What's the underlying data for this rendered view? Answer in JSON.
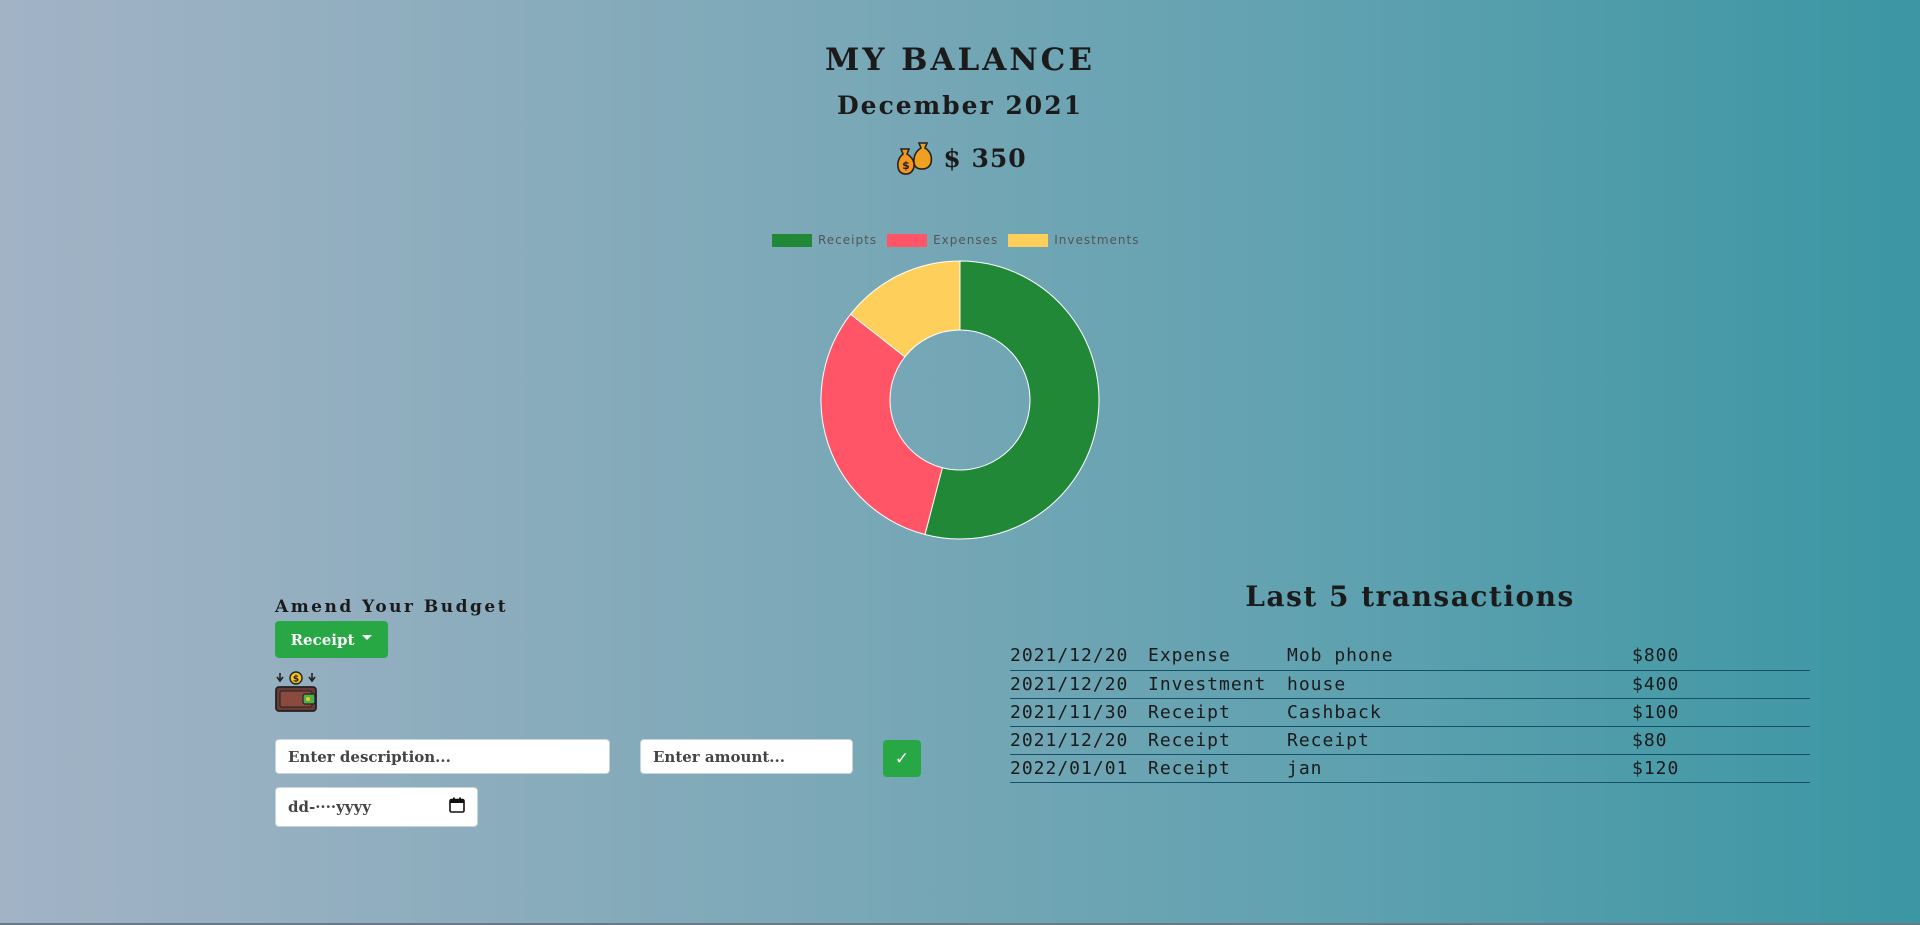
{
  "header": {
    "title": "MY BALANCE",
    "month": "December 2021",
    "balance": "$ 350",
    "balance_icon": "money-bags-icon"
  },
  "chart_data": {
    "type": "pie",
    "donut": true,
    "labels": [
      "Receipts",
      "Expenses",
      "Investments"
    ],
    "values": [
      300,
      175,
      80
    ],
    "colors": [
      "#218838",
      "#ff5566",
      "#ffcf5c"
    ],
    "legend": "top"
  },
  "budget_form": {
    "title": "Amend Your Budget",
    "type_dropdown": "Receipt",
    "type_icon": "wallet-icon",
    "description_placeholder": "Enter description...",
    "amount_placeholder": "Enter amount...",
    "submit_label": "✓",
    "date_placeholder": "dd-····yyyy",
    "calendar_icon": "calendar-icon"
  },
  "transactions": {
    "title": "Last 5 transactions",
    "rows": [
      {
        "date": "2021/12/20",
        "type": "Expense",
        "description": "Mob phone",
        "amount": "$800"
      },
      {
        "date": "2021/12/20",
        "type": "Investment",
        "description": "house",
        "amount": "$400"
      },
      {
        "date": "2021/11/30",
        "type": "Receipt",
        "description": "Cashback",
        "amount": "$100"
      },
      {
        "date": "2021/12/20",
        "type": "Receipt",
        "description": "Receipt",
        "amount": "$80"
      },
      {
        "date": "2022/01/01",
        "type": "Receipt",
        "description": "jan",
        "amount": "$120"
      }
    ]
  }
}
